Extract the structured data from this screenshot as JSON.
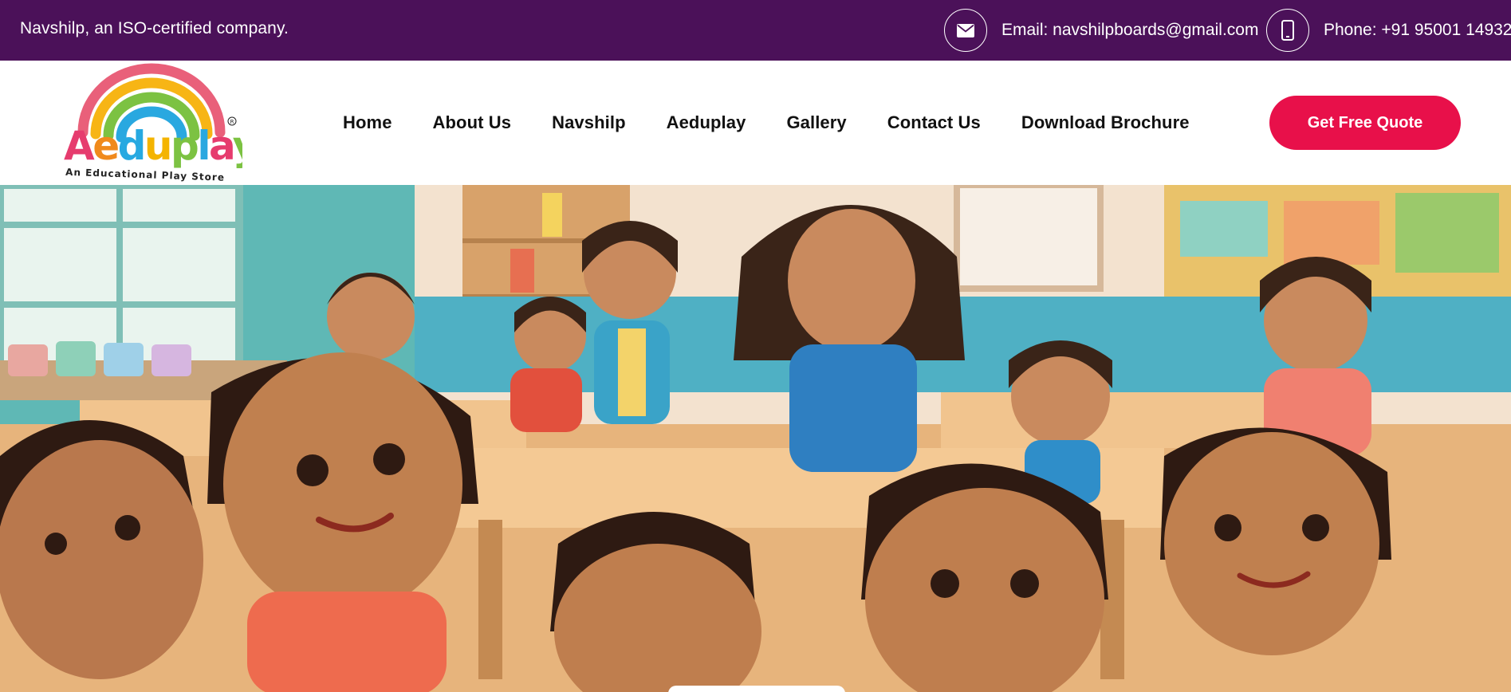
{
  "topbar": {
    "tagline": "Navshilp, an ISO-certified company.",
    "email": {
      "icon": "envelope-icon",
      "text": "Email: navshilpboards@gmail.com"
    },
    "phone": {
      "icon": "mobile-phone-icon",
      "text": "Phone: +91 95001 14932"
    }
  },
  "logo": {
    "brand": "Aeduplay",
    "tagline": "An Educational Play Store",
    "mark": "®"
  },
  "nav": {
    "items": [
      {
        "label": "Home"
      },
      {
        "label": "About Us"
      },
      {
        "label": "Navshilp"
      },
      {
        "label": "Aeduplay"
      },
      {
        "label": "Gallery"
      },
      {
        "label": "Contact Us"
      },
      {
        "label": "Download Brochure"
      }
    ]
  },
  "cta": {
    "label": "Get Free Quote"
  },
  "colors": {
    "topbar_bg": "#4b1159",
    "cta_bg": "#e8104a",
    "nav_text": "#111111"
  }
}
